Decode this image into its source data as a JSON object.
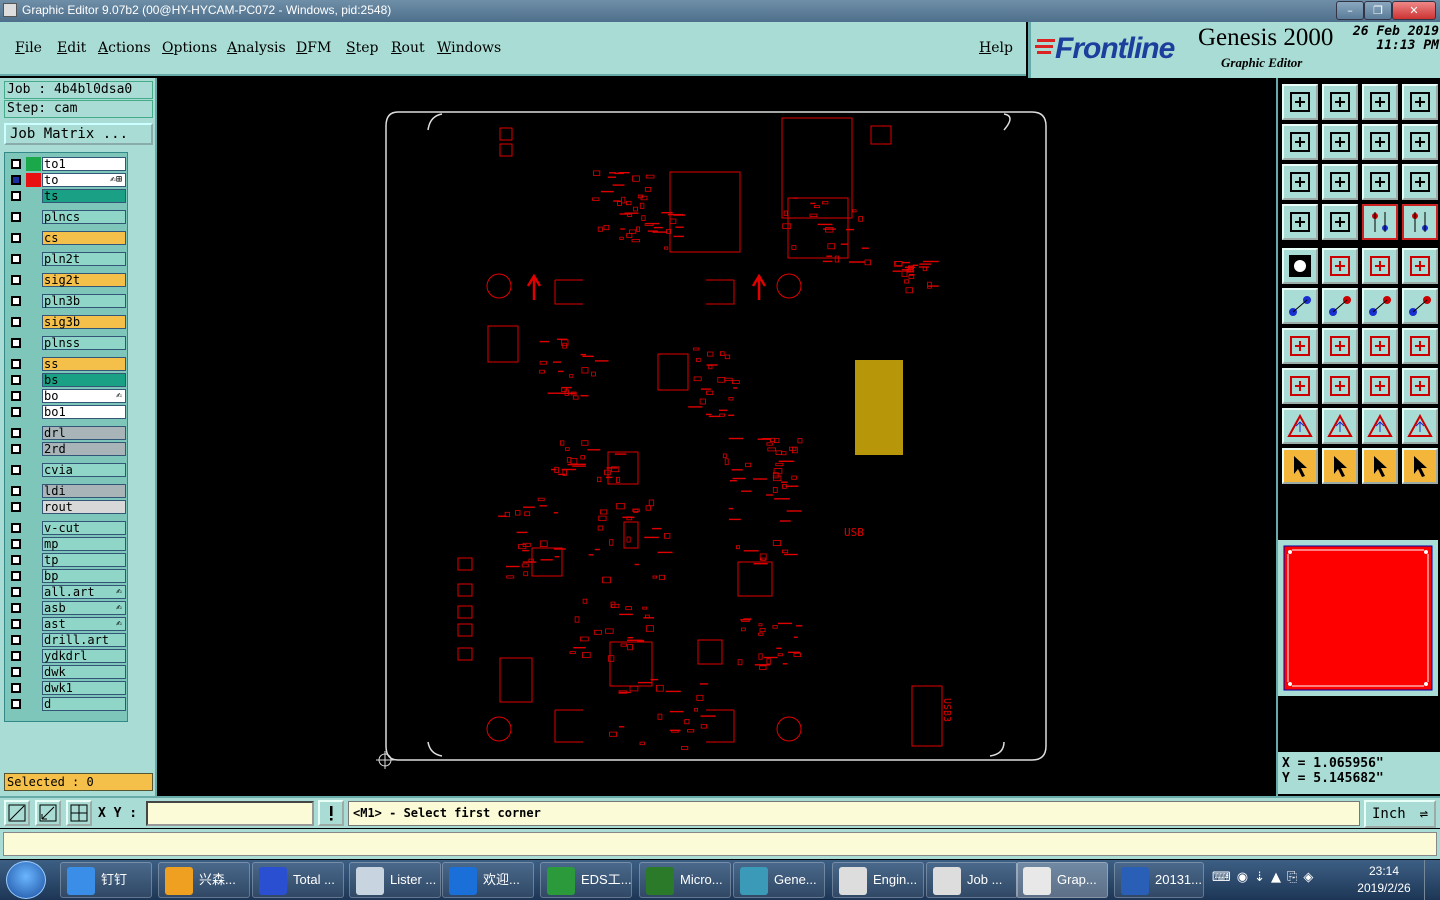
{
  "window": {
    "title": "Graphic Editor 9.07b2 (00@HY-HYCAM-PC072 - Windows, pid:2548)"
  },
  "menu": [
    "File",
    "Edit",
    "Actions",
    "Options",
    "Analysis",
    "DFM",
    "Step",
    "Rout",
    "Windows"
  ],
  "help": "Help",
  "brand": {
    "logo": "Frontline",
    "product": "Genesis 2000",
    "subtitle": "Graphic Editor",
    "date": "26 Feb 2019",
    "time": "11:13 PM"
  },
  "job": {
    "job_label": "Job : 4b4bl0dsa0",
    "step_label": "Step: cam",
    "matrix_button": "Job Matrix ..."
  },
  "layers": [
    {
      "name": "to1",
      "bg": "#ffffff",
      "sw": "#1aa84a",
      "mark": ""
    },
    {
      "name": "to",
      "bg": "#ffffff",
      "sw": "#e81010",
      "mark": "✍⊞",
      "cb": "#1a2fa0"
    },
    {
      "name": "ts",
      "bg": "#1aa084",
      "sw": "",
      "mark": ""
    },
    {
      "name": "plncs",
      "bg": "#8fd6c8",
      "sw": "",
      "mark": ""
    },
    {
      "name": "cs",
      "bg": "#f4c04a",
      "sw": "",
      "mark": ""
    },
    {
      "name": "pln2t",
      "bg": "#8fd6c8",
      "sw": "",
      "mark": ""
    },
    {
      "name": "sig2t",
      "bg": "#f4c04a",
      "sw": "",
      "mark": ""
    },
    {
      "name": "pln3b",
      "bg": "#8fd6c8",
      "sw": "",
      "mark": ""
    },
    {
      "name": "sig3b",
      "bg": "#f4c04a",
      "sw": "",
      "mark": ""
    },
    {
      "name": "plnss",
      "bg": "#8fd6c8",
      "sw": "",
      "mark": ""
    },
    {
      "name": "ss",
      "bg": "#f4c04a",
      "sw": "",
      "mark": ""
    },
    {
      "name": "bs",
      "bg": "#1aa084",
      "sw": "",
      "mark": ""
    },
    {
      "name": "bo",
      "bg": "#ffffff",
      "sw": "",
      "mark": "✍"
    },
    {
      "name": "bo1",
      "bg": "#ffffff",
      "sw": "",
      "mark": ""
    },
    {
      "name": "drl",
      "bg": "#a8b4b8",
      "sw": "",
      "mark": ""
    },
    {
      "name": "2rd",
      "bg": "#a8b4b8",
      "sw": "",
      "mark": ""
    },
    {
      "name": "cvia",
      "bg": "#8fd6c8",
      "sw": "",
      "mark": ""
    },
    {
      "name": "ldi",
      "bg": "#a8b4b8",
      "sw": "",
      "mark": ""
    },
    {
      "name": "rout",
      "bg": "#d8d8d8",
      "sw": "",
      "mark": ""
    },
    {
      "name": "v-cut",
      "bg": "#8fd6c8",
      "sw": "",
      "mark": ""
    },
    {
      "name": "mp",
      "bg": "#8fd6c8",
      "sw": "",
      "mark": ""
    },
    {
      "name": "tp",
      "bg": "#8fd6c8",
      "sw": "",
      "mark": ""
    },
    {
      "name": "bp",
      "bg": "#8fd6c8",
      "sw": "",
      "mark": ""
    },
    {
      "name": "all.art",
      "bg": "#8fd6c8",
      "sw": "",
      "mark": "✍"
    },
    {
      "name": "asb",
      "bg": "#8fd6c8",
      "sw": "",
      "mark": "✍"
    },
    {
      "name": "ast",
      "bg": "#8fd6c8",
      "sw": "",
      "mark": "✍"
    },
    {
      "name": "drill.art",
      "bg": "#8fd6c8",
      "sw": "",
      "mark": ""
    },
    {
      "name": "ydkdrl",
      "bg": "#8fd6c8",
      "sw": "",
      "mark": ""
    },
    {
      "name": "dwk",
      "bg": "#8fd6c8",
      "sw": "",
      "mark": ""
    },
    {
      "name": "dwk1",
      "bg": "#8fd6c8",
      "sw": "",
      "mark": ""
    },
    {
      "name": "d",
      "bg": "#8fd6c8",
      "sw": "",
      "mark": ""
    }
  ],
  "selected": "Selected : 0",
  "canvas_labels": {
    "usb": "USB",
    "usb3": "USB3"
  },
  "coords": {
    "x": "X = 1.065956\"",
    "y": "Y = 5.145682\""
  },
  "cmd": {
    "xy_label": "X Y :",
    "xy_value": "",
    "prompt": "<M1> - Select first corner",
    "unit": "Inch"
  },
  "taskbar": {
    "items": [
      "钉钉",
      "兴森...",
      "Total ...",
      "Lister ...",
      "欢迎...",
      "EDS工...",
      "Micro...",
      "Gene...",
      "Engin...",
      "Job ...",
      "Grap...",
      "20131..."
    ],
    "time": "23:14",
    "date": "2019/2/26"
  },
  "colors": {
    "panel": "#a9dcd4",
    "drawing": "#e00000",
    "highlight": "#f4c04a",
    "pad": "#b8960a"
  }
}
